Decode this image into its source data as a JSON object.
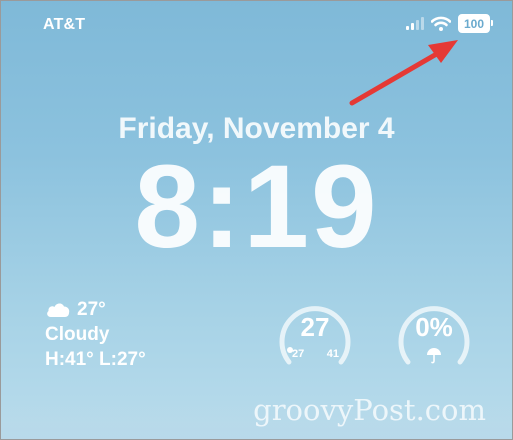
{
  "status_bar": {
    "carrier": "AT&T",
    "battery_level": "100",
    "icons": [
      "cellular-signal-icon",
      "wifi-icon",
      "battery-icon"
    ]
  },
  "lock_screen": {
    "date": "Friday, November 4",
    "time": "8:19"
  },
  "weather": {
    "icon": "cloud-icon",
    "temperature": "27°",
    "condition": "Cloudy",
    "high_low": "H:41° L:27°"
  },
  "temperature_gauge": {
    "current": "27",
    "low": "27",
    "high": "41"
  },
  "precipitation_gauge": {
    "value": "0%",
    "icon": "umbrella-icon"
  },
  "annotation": {
    "type": "red-arrow",
    "color": "#e53935",
    "points_to": "battery-percentage"
  },
  "watermark": "groovyPost.com",
  "colors": {
    "sky_top": "#7fb9d8",
    "sky_bottom": "#b9dcec",
    "text": "#ffffff"
  }
}
